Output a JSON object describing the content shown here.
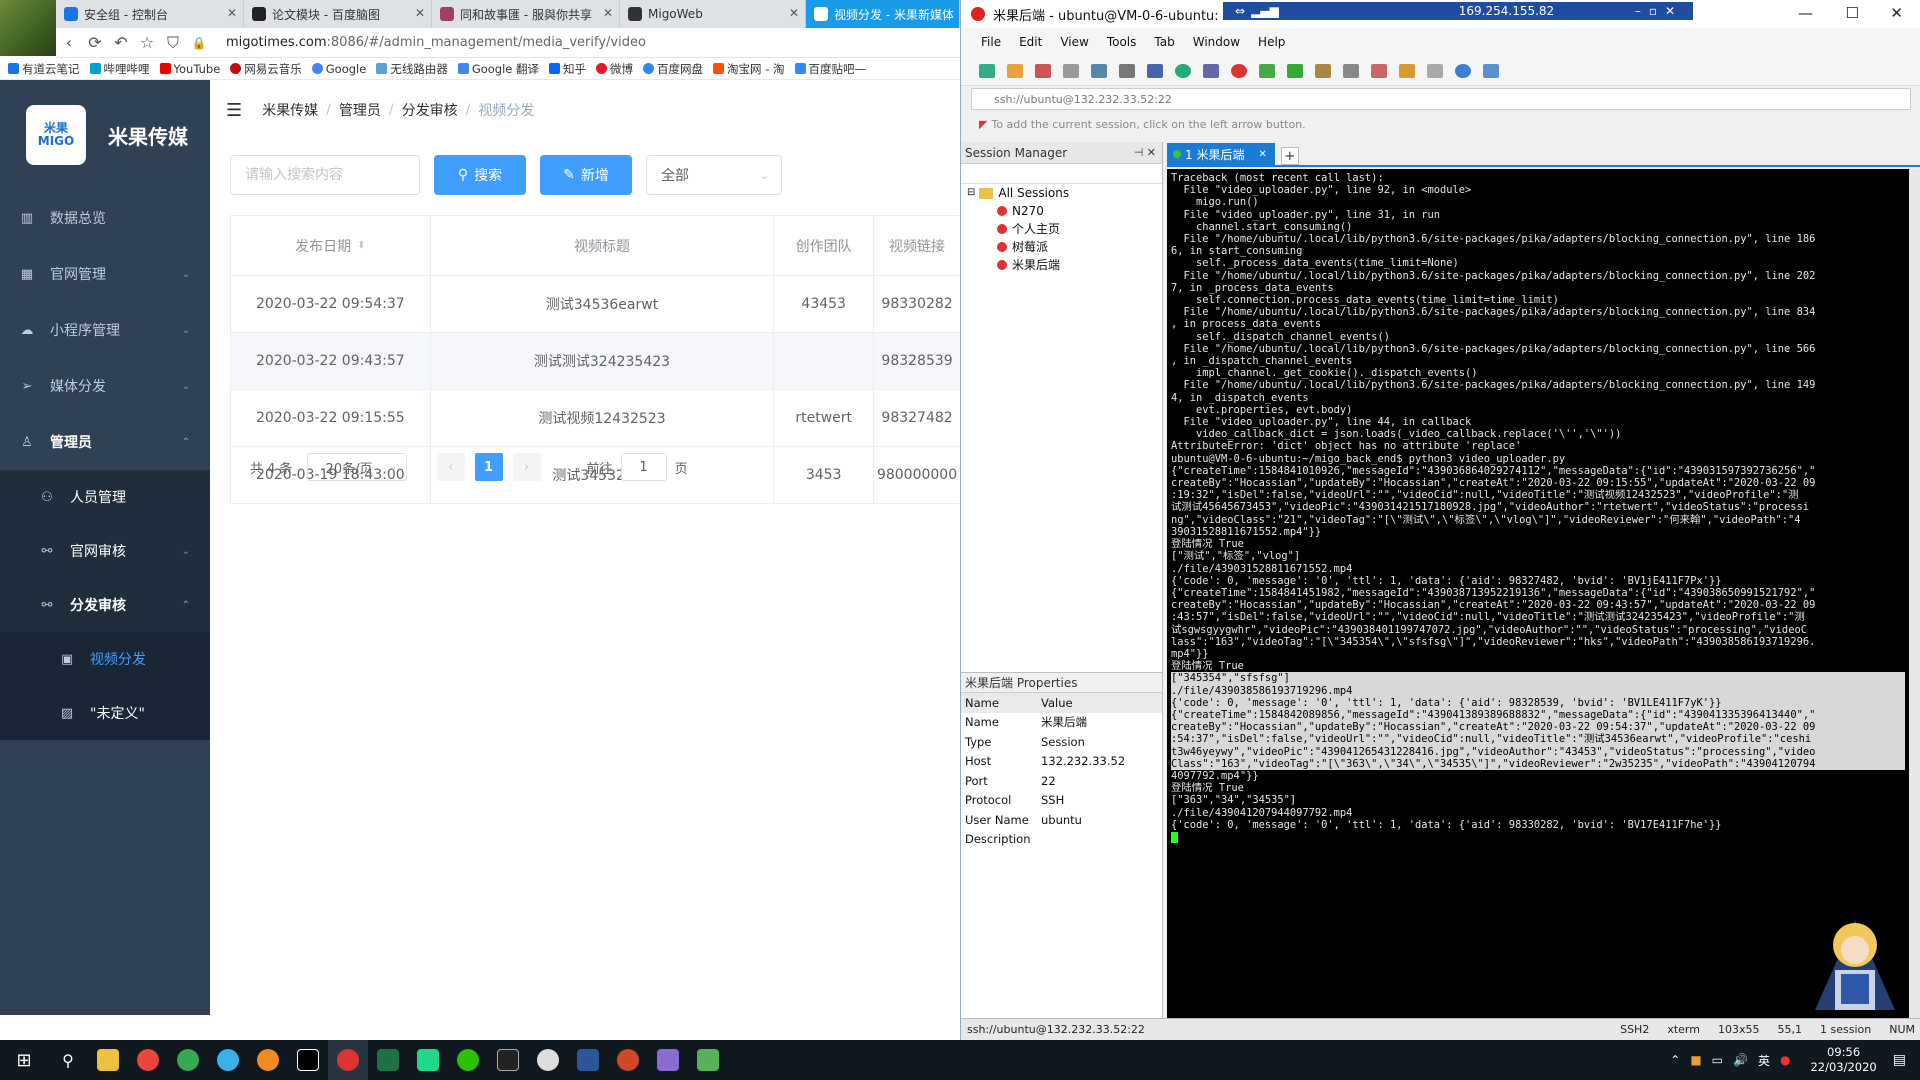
{
  "browser": {
    "tabs": [
      {
        "title": "安全组 - 控制台",
        "color": "#1a73e8"
      },
      {
        "title": "论文模块 - 百度脑图",
        "color": "#222"
      },
      {
        "title": "同和故事匯 - 服與你共享",
        "color": "#a04060"
      },
      {
        "title": "MigoWeb",
        "color": "#333"
      },
      {
        "title": "视频分发 - 米果新媒体",
        "color": "#1a9be8"
      }
    ],
    "url_host": "migotimes.com",
    "url_rest": ":8086/#/admin_management/media_verify/video",
    "bookmarks": [
      "有道云笔记",
      "哔哩哔哩",
      "YouTube",
      "网易云音乐",
      "Google",
      "无线路由器",
      "Google 翻译",
      "知乎",
      "微博",
      "百度网盘",
      "淘宝网 - 淘",
      "百度贴吧—"
    ]
  },
  "sidebar": {
    "logo_text": "米果 MIGO",
    "brand": "米果传媒",
    "items": [
      {
        "label": "数据总览",
        "icon": "chart-icon"
      },
      {
        "label": "官网管理",
        "icon": "grid-icon"
      },
      {
        "label": "小程序管理",
        "icon": "cloud-icon"
      },
      {
        "label": "媒体分发",
        "icon": "send-icon"
      },
      {
        "label": "管理员",
        "icon": "user-icon"
      }
    ],
    "sub_items": [
      "人员管理",
      "官网审核",
      "分发审核"
    ],
    "sub2_items": [
      "视频分发",
      "\"未定义\""
    ]
  },
  "breadcrumb": [
    "米果传媒",
    "管理员",
    "分发审核",
    "视频分发"
  ],
  "toolbar": {
    "search_placeholder": "请输入搜索内容",
    "search_label": "搜索",
    "add_label": "新增",
    "filter_value": "全部"
  },
  "table": {
    "headers": [
      "发布日期",
      "视频标题",
      "创作团队",
      "视频链接"
    ],
    "rows": [
      [
        "2020-03-22 09:54:37",
        "测试34536earwt",
        "43453",
        "98330282"
      ],
      [
        "2020-03-22 09:43:57",
        "测试测试324235423",
        "",
        "98328539"
      ],
      [
        "2020-03-22 09:15:55",
        "测试视频12432523",
        "rtetwert",
        "98327482"
      ],
      [
        "2020-03-19 18:43:00",
        "测试34532525",
        "3453",
        "980000000"
      ]
    ]
  },
  "pager": {
    "total": "共 4 条",
    "page_size": "20条/页",
    "current": "1",
    "goto_prefix": "前往",
    "goto_value": "1",
    "goto_suffix": "页"
  },
  "xshell": {
    "title": "米果后端 - ubuntu@VM-0-6-ubuntu: ~",
    "remote_ip": "169.254.155.82",
    "menu": [
      "File",
      "Edit",
      "View",
      "Tools",
      "Tab",
      "Window",
      "Help"
    ],
    "address": "ssh://ubuntu@132.232.33.52:22",
    "hint": "To add the current session, click on the left arrow button.",
    "session_manager": "Session Manager",
    "sessions_root": "All Sessions",
    "sessions": [
      "N270",
      "个人主页",
      "树莓派",
      "米果后端"
    ],
    "tab_label": "1 米果后端",
    "properties_title": "米果后端 Properties",
    "props_header": [
      "Name",
      "Value"
    ],
    "props": [
      [
        "Name",
        "米果后端"
      ],
      [
        "Type",
        "Session"
      ],
      [
        "Host",
        "132.232.33.52"
      ],
      [
        "Port",
        "22"
      ],
      [
        "Protocol",
        "SSH"
      ],
      [
        "User Name",
        "ubuntu"
      ],
      [
        "Description",
        ""
      ]
    ],
    "status_left": "ssh://ubuntu@132.232.33.52:22",
    "status_right": [
      "SSH2",
      "xterm",
      "103x55",
      "55,1",
      "1 session",
      "NUM"
    ],
    "terminal_lines": [
      "Traceback (most recent call last):",
      "  File \"video_uploader.py\", line 92, in <module>",
      "    migo.run()",
      "  File \"video_uploader.py\", line 31, in run",
      "    channel.start_consuming()",
      "  File \"/home/ubuntu/.local/lib/python3.6/site-packages/pika/adapters/blocking_connection.py\", line 186",
      "6, in start_consuming",
      "    self._process_data_events(time_limit=None)",
      "  File \"/home/ubuntu/.local/lib/python3.6/site-packages/pika/adapters/blocking_connection.py\", line 202",
      "7, in _process_data_events",
      "    self.connection.process_data_events(time_limit=time_limit)",
      "  File \"/home/ubuntu/.local/lib/python3.6/site-packages/pika/adapters/blocking_connection.py\", line 834",
      ", in process_data_events",
      "    self._dispatch_channel_events()",
      "  File \"/home/ubuntu/.local/lib/python3.6/site-packages/pika/adapters/blocking_connection.py\", line 566",
      ", in _dispatch_channel_events",
      "    impl_channel._get_cookie()._dispatch_events()",
      "  File \"/home/ubuntu/.local/lib/python3.6/site-packages/pika/adapters/blocking_connection.py\", line 149",
      "4, in _dispatch_events",
      "    evt.properties, evt.body)",
      "  File \"video_uploader.py\", line 44, in callback",
      "    video_callback_dict = json.loads(_video_callback.replace('\\'','\\\"'))",
      "AttributeError: 'dict' object has no attribute 'replace'",
      "ubuntu@VM-0-6-ubuntu:~/migo_back_end$ python3 video_uploader.py",
      "{\"createTime\":1584841010926,\"messageId\":\"439036864029274112\",\"messageData\":{\"id\":\"439031597392736256\",\"",
      "createBy\":\"Hocassian\",\"updateBy\":\"Hocassian\",\"createAt\":\"2020-03-22 09:15:55\",\"updateAt\":\"2020-03-22 09",
      ":19:32\",\"isDel\":false,\"videoUrl\":\"\",\"videoCid\":null,\"videoTitle\":\"测试视频12432523\",\"videoProfile\":\"测",
      "试测试45645673453\",\"videoPic\":\"439031421517180928.jpg\",\"videoAuthor\":\"rtetwert\",\"videoStatus\":\"processi",
      "ng\",\"videoClass\":\"21\",\"videoTag\":\"[\\\"测试\\\",\\\"标签\\\",\\\"vlog\\\"]\",\"videoReviewer\":\"何来翰\",\"videoPath\":\"4",
      "39031528811671552.mp4\"}}",
      "登陆情况 True",
      "[\"测试\",\"标签\",\"vlog\"]",
      "./file/439031528811671552.mp4",
      "{'code': 0, 'message': '0', 'ttl': 1, 'data': {'aid': 98327482, 'bvid': 'BV1jE411F7Px'}}",
      "{\"createTime\":1584841451982,\"messageId\":\"439038713952219136\",\"messageData\":{\"id\":\"439038650991521792\",\"",
      "createBy\":\"Hocassian\",\"updateBy\":\"Hocassian\",\"createAt\":\"2020-03-22 09:43:57\",\"updateAt\":\"2020-03-22 09",
      ":43:57\",\"isDel\":false,\"videoUrl\":\"\",\"videoCid\":null,\"videoTitle\":\"测试测试324235423\",\"videoProfile\":\"测",
      "试sgwsgyygwhr\",\"videoPic\":\"439038401199747072.jpg\",\"videoAuthor\":\"\",\"videoStatus\":\"processing\",\"videoC",
      "lass\":\"163\",\"videoTag\":\"[\\\"345354\\\",\\\"sfsfsg\\\"]\",\"videoReviewer\":\"hks\",\"videoPath\":\"439038586193719296.",
      "mp4\"}}",
      "登陆情况 True",
      "[\"345354\",\"sfsfsg\"]",
      "./file/439038586193719296.mp4",
      "{'code': 0, 'message': '0', 'ttl': 1, 'data': {'aid': 98328539, 'bvid': 'BV1LE411F7yK'}}",
      "{\"createTime\":1584842089856,\"messageId\":\"439041389389688832\",\"messageData\":{\"id\":\"439041335396413440\",\"",
      "createBy\":\"Hocassian\",\"updateBy\":\"Hocassian\",\"createAt\":\"2020-03-22 09:54:37\",\"updateAt\":\"2020-03-22 09",
      ":54:37\",\"isDel\":false,\"videoUrl\":\"\",\"videoCid\":null,\"videoTitle\":\"测试34536earwt\",\"videoProfile\":\"ceshi",
      "t3w46yeywy\",\"videoPic\":\"439041265431228416.jpg\",\"videoAuthor\":\"43453\",\"videoStatus\":\"processing\",\"video",
      "Class\":\"163\",\"videoTag\":\"[\\\"363\\\",\\\"34\\\",\\\"34535\\\"]\",\"videoReviewer\":\"2w35235\",\"videoPath\":\"43904120794",
      "4097792.mp4\"}}",
      "登陆情况 True",
      "[\"363\",\"34\",\"34535\"]",
      "./file/439041207944097792.mp4",
      "{'code': 0, 'message': '0', 'ttl': 1, 'data': {'aid': 98330282, 'bvid': 'BV17E411F7he'}}"
    ]
  },
  "taskbar": {
    "time": "09:56",
    "date": "22/03/2020",
    "lang": "英"
  }
}
